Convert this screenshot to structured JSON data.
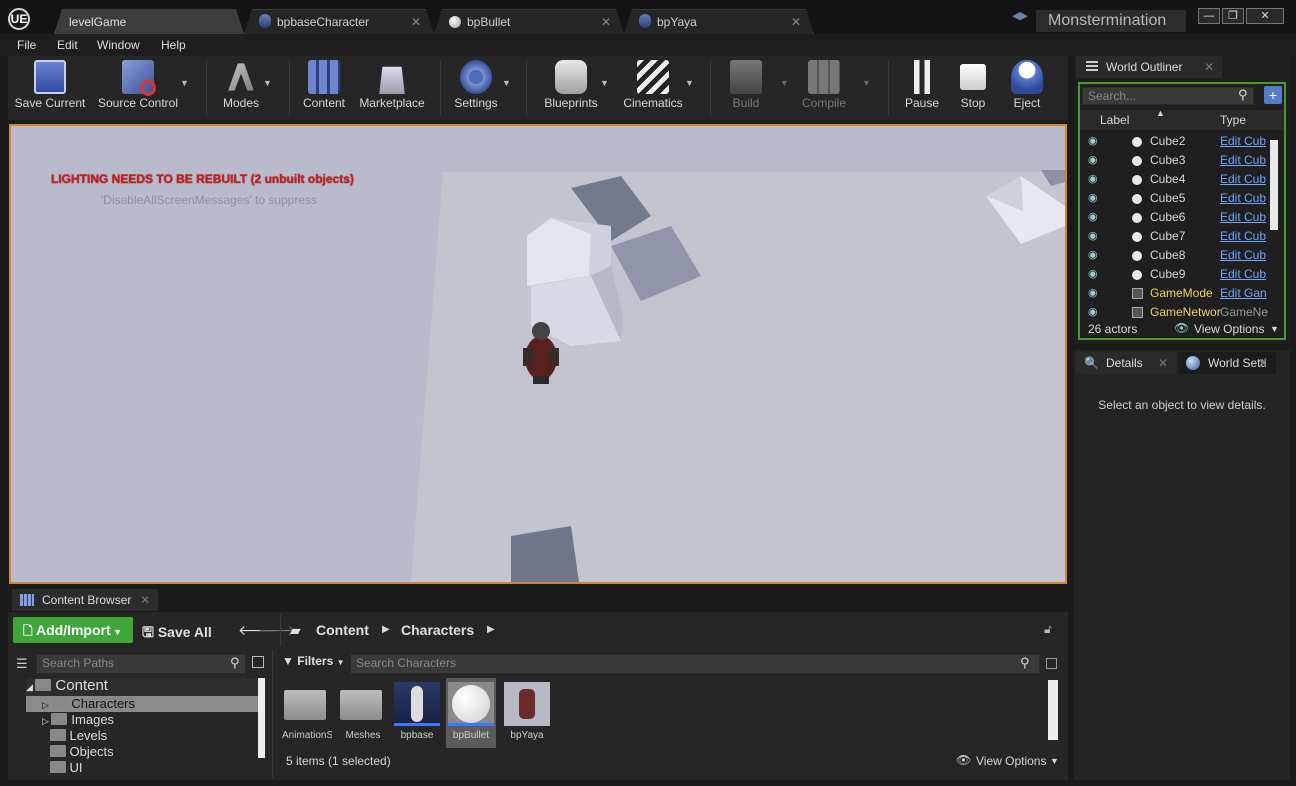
{
  "titlebar": {
    "logo": "UE",
    "tabs": [
      {
        "label": "levelGame",
        "icon": "level-icon",
        "active": true
      },
      {
        "label": "bpbaseCharacter",
        "icon": "blueprint-icon"
      },
      {
        "label": "bpBullet",
        "icon": "sphere-icon"
      },
      {
        "label": "bpYaya",
        "icon": "blueprint-icon"
      }
    ],
    "project_name": "Monstermination",
    "window_buttons": [
      "—",
      "❐",
      "✕"
    ]
  },
  "menu": {
    "items": [
      "File",
      "Edit",
      "Window",
      "Help"
    ]
  },
  "toolbar": {
    "buttons": [
      {
        "label": "Save Current",
        "icon": "save-icon"
      },
      {
        "label": "Source Control",
        "icon": "source-control-icon"
      },
      {
        "label": "Modes",
        "icon": "modes-icon"
      },
      {
        "label": "Content",
        "icon": "content-icon"
      },
      {
        "label": "Marketplace",
        "icon": "marketplace-icon"
      },
      {
        "label": "Settings",
        "icon": "settings-icon"
      },
      {
        "label": "Blueprints",
        "icon": "blueprints-icon"
      },
      {
        "label": "Cinematics",
        "icon": "cinematics-icon"
      },
      {
        "label": "Build",
        "icon": "build-icon",
        "disabled": true
      },
      {
        "label": "Compile",
        "icon": "compile-icon",
        "disabled": true
      },
      {
        "label": "Pause",
        "icon": "pause-icon"
      },
      {
        "label": "Stop",
        "icon": "stop-icon"
      },
      {
        "label": "Eject",
        "icon": "eject-icon"
      }
    ]
  },
  "viewport": {
    "warning": "LIGHTING NEEDS TO BE REBUILT (2 unbuilt objects)",
    "suppress": "'DisableAllScreenMessages' to suppress"
  },
  "outliner": {
    "title": "World Outliner",
    "search_placeholder": "Search...",
    "col_label": "Label",
    "col_type": "Type",
    "rows": [
      {
        "label": "Cube2",
        "type": "Edit Cub"
      },
      {
        "label": "Cube3",
        "type": "Edit Cub"
      },
      {
        "label": "Cube4",
        "type": "Edit Cub"
      },
      {
        "label": "Cube5",
        "type": "Edit Cub"
      },
      {
        "label": "Cube6",
        "type": "Edit Cub"
      },
      {
        "label": "Cube7",
        "type": "Edit Cub"
      },
      {
        "label": "Cube8",
        "type": "Edit Cub"
      },
      {
        "label": "Cube9",
        "type": "Edit Cub"
      },
      {
        "label": "GameMode",
        "type": "Edit Gan"
      },
      {
        "label": "GameNetwor",
        "type": "GameNet"
      }
    ],
    "actor_count": "26 actors",
    "view_options": "View Options"
  },
  "details": {
    "tab_details": "Details",
    "tab_world": "World Setti",
    "empty_message": "Select an object to view details."
  },
  "content_browser": {
    "tab": "Content Browser",
    "add_import": "Add/Import",
    "save_all": "Save All",
    "path": [
      "Content",
      "Characters"
    ],
    "search_paths_placeholder": "Search Paths",
    "filters": "Filters",
    "search_placeholder": "Search Characters",
    "tree": [
      {
        "label": "Content",
        "root": true
      },
      {
        "label": "Characters",
        "selected": true
      },
      {
        "label": "Images"
      },
      {
        "label": "Levels"
      },
      {
        "label": "Objects"
      },
      {
        "label": "UI"
      }
    ],
    "assets": [
      {
        "label": "AnimationS",
        "kind": "folder"
      },
      {
        "label": "Meshes",
        "kind": "folder"
      },
      {
        "label": "bpbase",
        "kind": "blueprint"
      },
      {
        "label": "bpBullet",
        "kind": "sphere",
        "selected": true
      },
      {
        "label": "bpYaya",
        "kind": "character"
      }
    ],
    "status": "5 items (1 selected)",
    "view_options": "View Options"
  }
}
